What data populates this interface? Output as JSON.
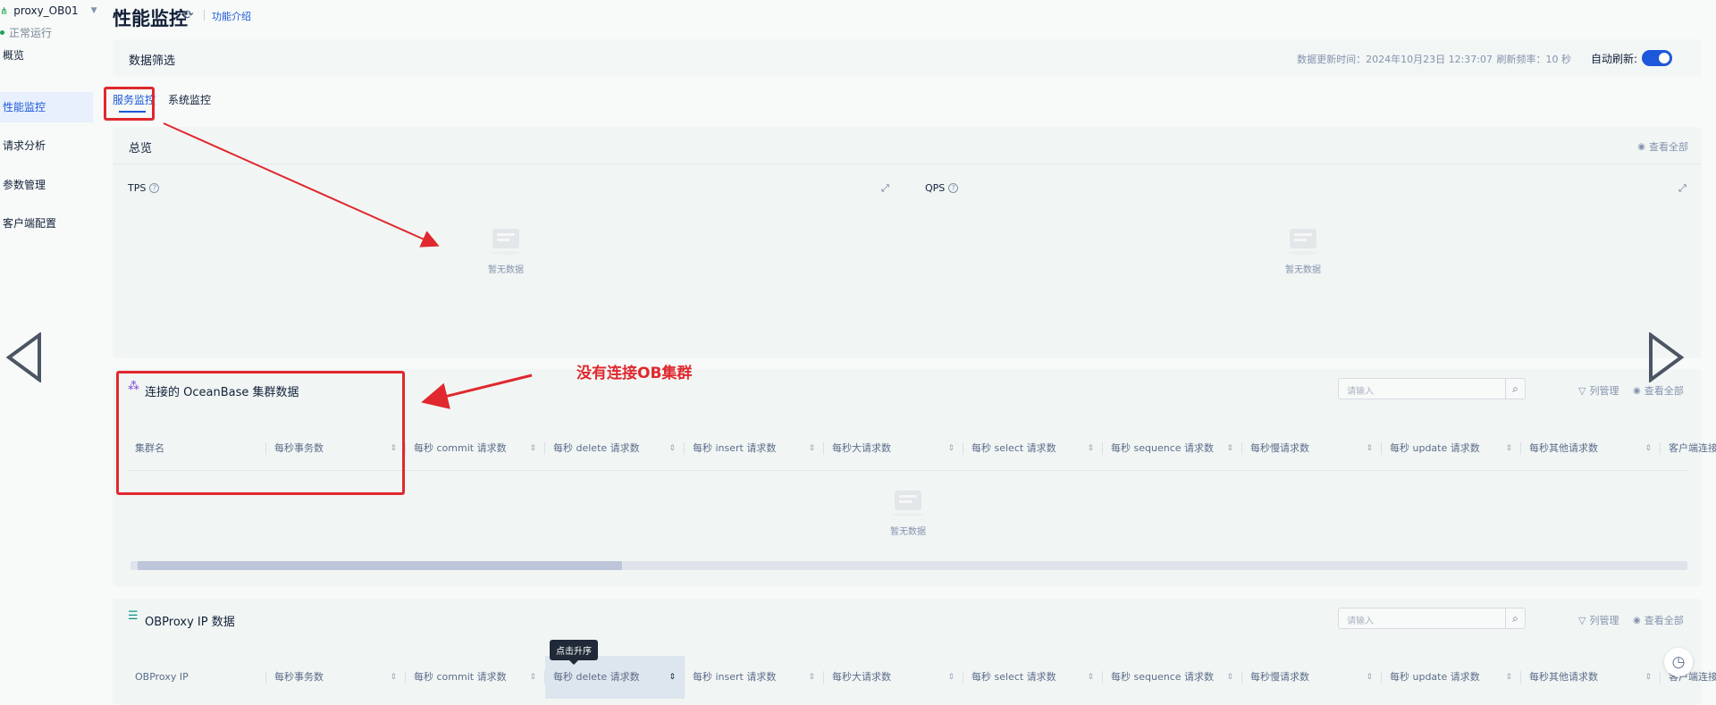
{
  "sidebar": {
    "cluster_name": "proxy_OB01",
    "status": "正常运行",
    "items": [
      {
        "label": "概览"
      },
      {
        "label": "性能监控"
      },
      {
        "label": "请求分析"
      },
      {
        "label": "参数管理"
      },
      {
        "label": "客户端配置"
      }
    ]
  },
  "header": {
    "title": "性能监控",
    "intro_link": "功能介绍"
  },
  "filter": {
    "title": "数据筛选",
    "update_time": "数据更新时间：2024年10月23日 12:37:07",
    "refresh_rate": "刷新频率：10 秒",
    "auto_refresh_label": "自动刷新:",
    "auto_refresh_on": true
  },
  "tabs": [
    {
      "label": "服务监控",
      "active": true
    },
    {
      "label": "系统监控",
      "active": false
    }
  ],
  "overview": {
    "title": "总览",
    "view_all": "查看全部",
    "charts": [
      {
        "label": "TPS",
        "empty_text": "暂无数据"
      },
      {
        "label": "QPS",
        "empty_text": "暂无数据"
      }
    ]
  },
  "annotation": "没有连接OB集群",
  "cluster_table": {
    "title": "连接的 OceanBase 集群数据",
    "search_placeholder": "请输入",
    "column_manage": "列管理",
    "view_all": "查看全部",
    "columns": [
      "集群名",
      "每秒事务数",
      "每秒 commit 请求数",
      "每秒 delete 请求数",
      "每秒 insert 请求数",
      "每秒大请求数",
      "每秒 select 请求数",
      "每秒 sequence 请求数",
      "每秒慢请求数",
      "每秒 update 请求数",
      "每秒其他请求数",
      "客户端连接数"
    ],
    "empty_text": "暂无数据"
  },
  "obproxy_table": {
    "title": "OBProxy IP 数据",
    "search_placeholder": "请输入",
    "column_manage": "列管理",
    "view_all": "查看全部",
    "columns": [
      "OBProxy IP",
      "每秒事务数",
      "每秒 commit 请求数",
      "每秒 delete 请求数",
      "每秒 insert 请求数",
      "每秒大请求数",
      "每秒 select 请求数",
      "每秒 sequence 请求数",
      "每秒慢请求数",
      "每秒 update 请求数",
      "每秒其他请求数",
      "客户端连接数"
    ],
    "tooltip": "点击升序"
  },
  "colors": {
    "accent": "#1c58d9",
    "annotation_red": "#e0282e",
    "status_green": "#1fa15a"
  }
}
